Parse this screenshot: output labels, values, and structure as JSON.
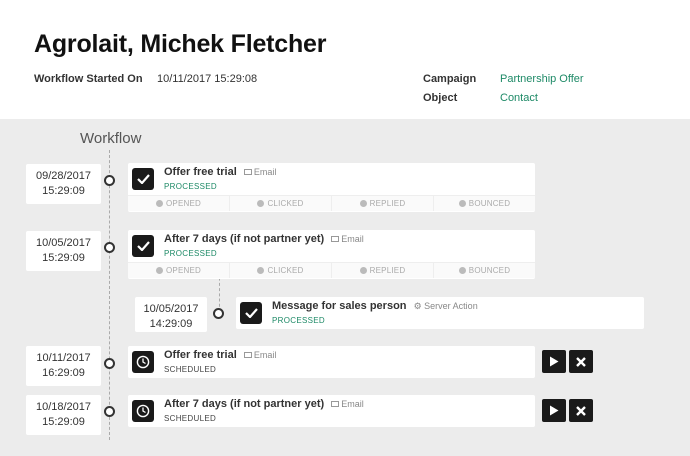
{
  "header": {
    "title": "Agrolait, Michek Fletcher",
    "started_label": "Workflow Started On",
    "started_value": "10/11/2017 15:29:08",
    "campaign_label": "Campaign",
    "campaign_value": "Partnership Offer",
    "object_label": "Object",
    "object_value": "Contact"
  },
  "workflow": {
    "title": "Workflow",
    "activities": [
      {
        "date": "09/28/2017",
        "time": "15:29:09",
        "title": "Offer free trial",
        "type": "Email",
        "status": "PROCESSED",
        "stats": [
          "OPENED",
          "CLICKED",
          "REPLIED",
          "BOUNCED"
        ]
      },
      {
        "date": "10/05/2017",
        "time": "15:29:09",
        "title": "7 days (if not partner yet)",
        "type": "Email",
        "status": "PROCESSED",
        "stats": [
          "OPENED",
          "CLICKED",
          "REPLIED",
          "BOUNCED"
        ]
      },
      {
        "date": "10/05/2017",
        "time": "14:29:09",
        "title": "Message for sales person",
        "type": "Server Action",
        "status": "PROCESSED"
      },
      {
        "date": "10/11/2017",
        "time": "16:29:09",
        "title": "Offer free trial",
        "type": "Email",
        "status": "SCHEDULED"
      },
      {
        "date": "10/18/2017",
        "time": "15:29:09",
        "title": "7 days (if not partner yet)",
        "type": "Email",
        "status": "SCHEDULED"
      }
    ]
  },
  "colors": {
    "accent": "#1e8a67",
    "icon_bg": "#1a1a1a",
    "background": "#ececec"
  },
  "icons": {
    "done": "check-icon",
    "scheduled": "clock-icon",
    "run": "play-icon",
    "cancel": "close-icon"
  }
}
